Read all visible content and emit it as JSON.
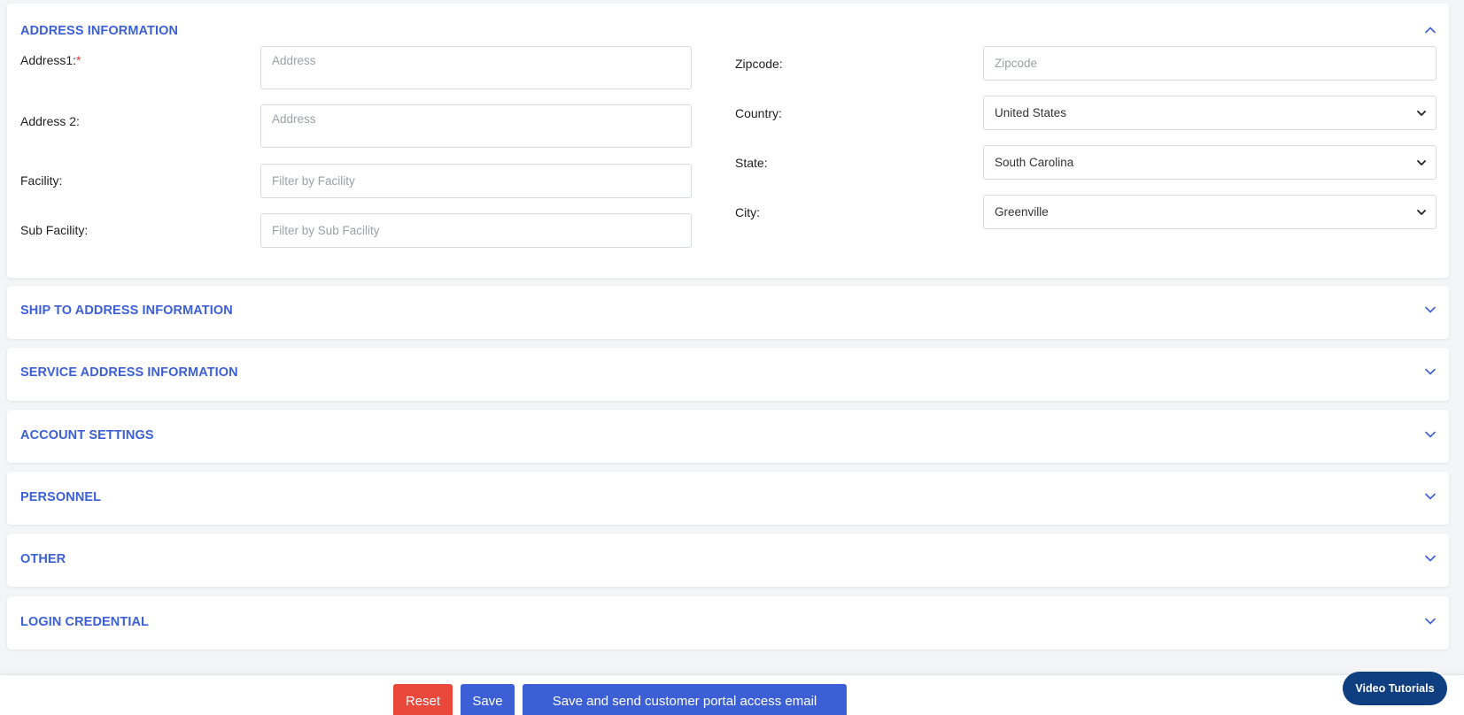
{
  "colors": {
    "accent": "#3c5fd6",
    "danger": "#e9483b",
    "dark_pill": "#0f3f80",
    "required": "#e53935"
  },
  "address_info": {
    "title": "ADDRESS INFORMATION",
    "toggle_icon": "chevron-up-icon",
    "address1_label": "Address1:",
    "address1_required": "*",
    "address1_placeholder": "Address",
    "address2_label": "Address 2:",
    "address2_placeholder": "Address",
    "facility_label": "Facility:",
    "facility_placeholder": "Filter by Facility",
    "sub_facility_label": "Sub Facility:",
    "sub_facility_placeholder": "Filter by Sub Facility",
    "zipcode_label": "Zipcode:",
    "zipcode_placeholder": "Zipcode",
    "country_label": "Country:",
    "country_value": "United States",
    "state_label": "State:",
    "state_value": "South Carolina",
    "city_label": "City:",
    "city_value": "Greenville"
  },
  "sections": [
    {
      "title": "SHIP TO ADDRESS INFORMATION",
      "icon": "chevron-down-icon"
    },
    {
      "title": "SERVICE ADDRESS INFORMATION",
      "icon": "chevron-down-icon"
    },
    {
      "title": "ACCOUNT SETTINGS",
      "icon": "chevron-down-icon"
    },
    {
      "title": "PERSONNEL",
      "icon": "chevron-down-icon"
    },
    {
      "title": "OTHER",
      "icon": "chevron-down-icon"
    },
    {
      "title": "LOGIN CREDENTIAL",
      "icon": "chevron-down-icon"
    }
  ],
  "footer": {
    "reset_label": "Reset",
    "save_label": "Save",
    "save_send_label": "Save and send customer portal access email"
  },
  "video_tutorials_label": "Video Tutorials"
}
